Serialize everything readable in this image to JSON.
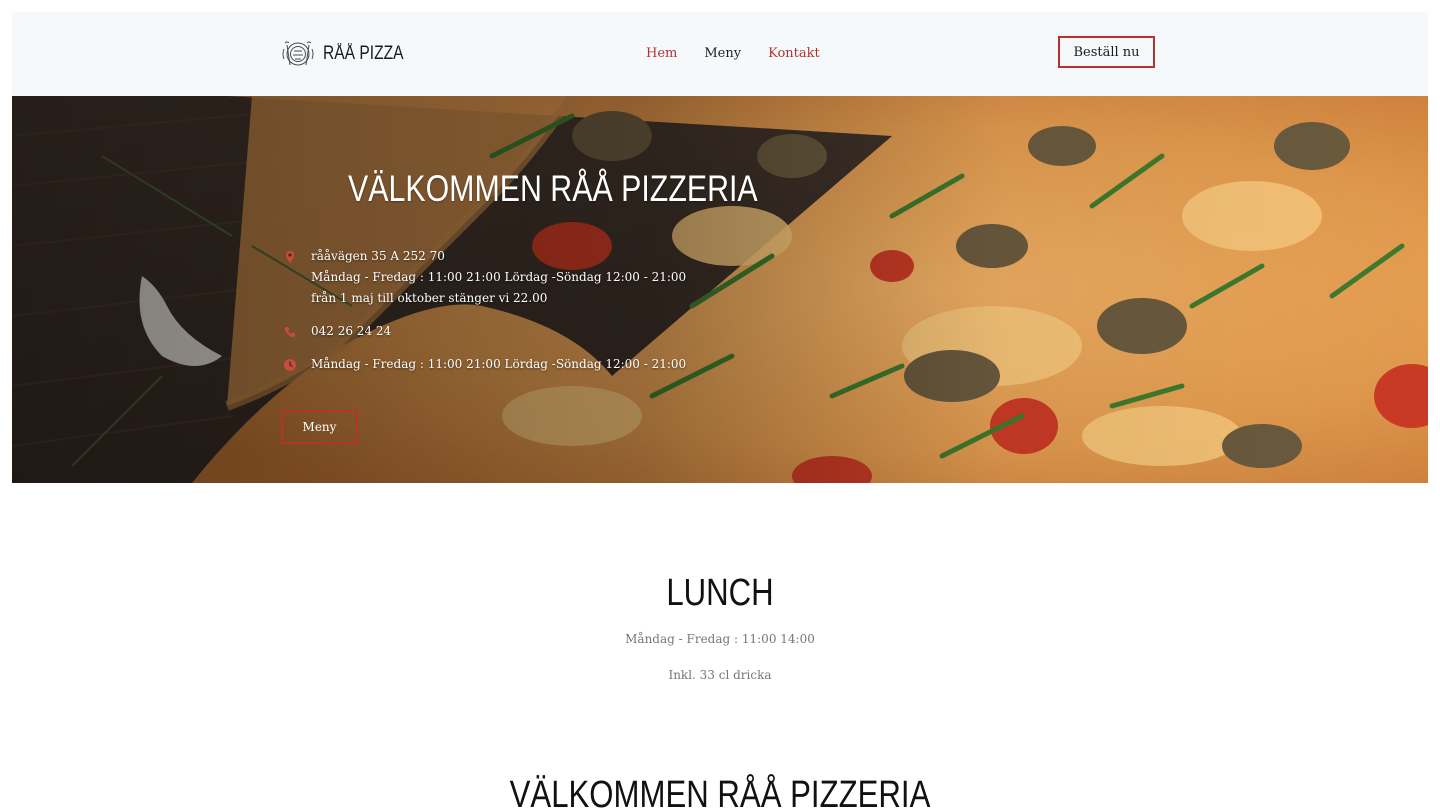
{
  "header": {
    "logo_text": "RÅÅ PIZZA",
    "nav": {
      "home": "Hem",
      "menu": "Meny",
      "contact": "Kontakt"
    },
    "order_button": "Beställ nu"
  },
  "hero": {
    "title": "VÄLKOMMEN RÅÅ PIZZERIA",
    "address": {
      "icon": "map-pin-icon",
      "lines": [
        "rååvägen 35 A 252 70",
        "Måndag - Fredag : 11:00 21:00 Lördag -Söndag 12:00 - 21:00",
        "från 1 maj till oktober stänger vi 22.00"
      ]
    },
    "phone": {
      "icon": "phone-icon",
      "text": "042 26 24 24"
    },
    "hours": {
      "icon": "clock-icon",
      "text": "Måndag - Fredag : 11:00 21:00 Lördag -Söndag 12:00 - 21:00"
    },
    "menu_button": "Meny"
  },
  "lunch": {
    "title": "LUNCH",
    "hours": "Måndag - Fredag : 11:00 14:00",
    "note": "Inkl. 33 cl dricka"
  },
  "welcome_section": {
    "title": "VÄLKOMMEN RÅÅ PIZZERIA"
  },
  "colors": {
    "accent": "#b5322e",
    "header_bg": "#f6f9fc",
    "text_dark": "#1c1c1c",
    "text_muted": "#767676"
  }
}
